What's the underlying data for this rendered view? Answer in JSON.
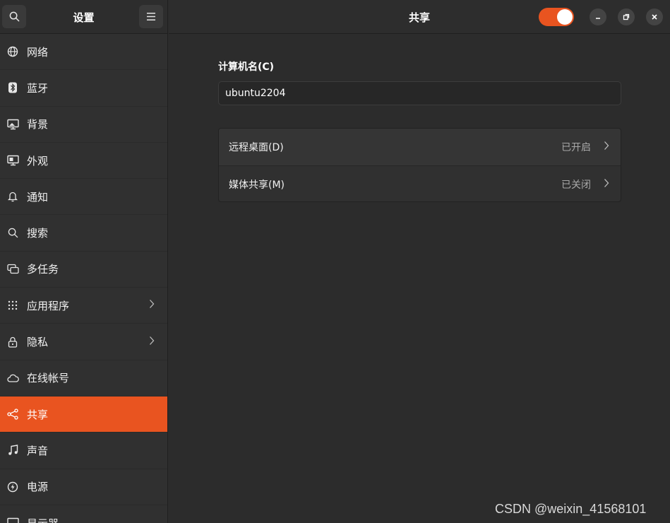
{
  "sidebar": {
    "title": "设置",
    "search_icon": "search-icon",
    "menu_icon": "hamburger-menu-icon",
    "items": [
      {
        "label": "网络",
        "icon": "network-icon"
      },
      {
        "label": "蓝牙",
        "icon": "bluetooth-icon"
      },
      {
        "label": "背景",
        "icon": "background-icon"
      },
      {
        "label": "外观",
        "icon": "appearance-icon"
      },
      {
        "label": "通知",
        "icon": "bell-icon"
      },
      {
        "label": "搜索",
        "icon": "search-icon"
      },
      {
        "label": "多任务",
        "icon": "multitasking-icon"
      },
      {
        "label": "应用程序",
        "icon": "apps-grid-icon",
        "has_chevron": true
      },
      {
        "label": "隐私",
        "icon": "lock-icon",
        "has_chevron": true
      },
      {
        "label": "在线帐号",
        "icon": "cloud-icon"
      },
      {
        "label": "共享",
        "icon": "share-icon",
        "active": true
      },
      {
        "label": "声音",
        "icon": "music-note-icon"
      },
      {
        "label": "电源",
        "icon": "power-icon"
      },
      {
        "label": "显示器",
        "icon": "display-icon"
      }
    ]
  },
  "header": {
    "title": "共享",
    "sharing_toggle": "on"
  },
  "main": {
    "computer_name_label": "计算机名(C)",
    "computer_name_value": "ubuntu2204",
    "rows": [
      {
        "label": "远程桌面(D)",
        "status": "已开启"
      },
      {
        "label": "媒体共享(M)",
        "status": "已关闭"
      }
    ]
  },
  "watermark": "CSDN @weixin_41568101",
  "colors": {
    "accent": "#e95420",
    "background": "#2c2c2c",
    "sidebar": "#303030"
  }
}
